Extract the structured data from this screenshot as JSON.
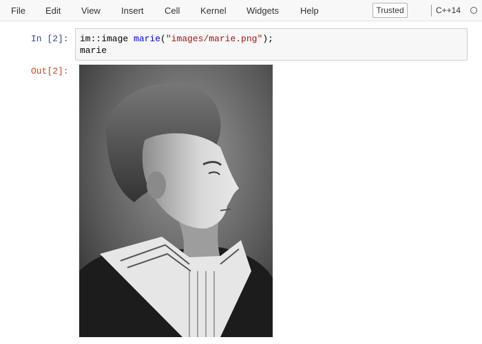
{
  "menu": {
    "items": [
      "File",
      "Edit",
      "View",
      "Insert",
      "Cell",
      "Kernel",
      "Widgets",
      "Help"
    ],
    "trusted_label": "Trusted",
    "kernel_name": "C++14",
    "kernel_status_icon": "circle-outline-icon"
  },
  "cells": {
    "input": {
      "prompt": "In [2]:",
      "line1_part1": "im::image ",
      "line1_part2": "marie",
      "line1_part3": "(",
      "line1_part4": "\"images/marie.png\"",
      "line1_part5": ");",
      "line2": "marie"
    },
    "output": {
      "prompt": "Out[2]:",
      "image_alt": "portrait-photo"
    }
  },
  "colors": {
    "in_prompt": "#303f9f",
    "out_prompt": "#d84315",
    "string": "#aa1111",
    "variable": "#0000ff"
  }
}
